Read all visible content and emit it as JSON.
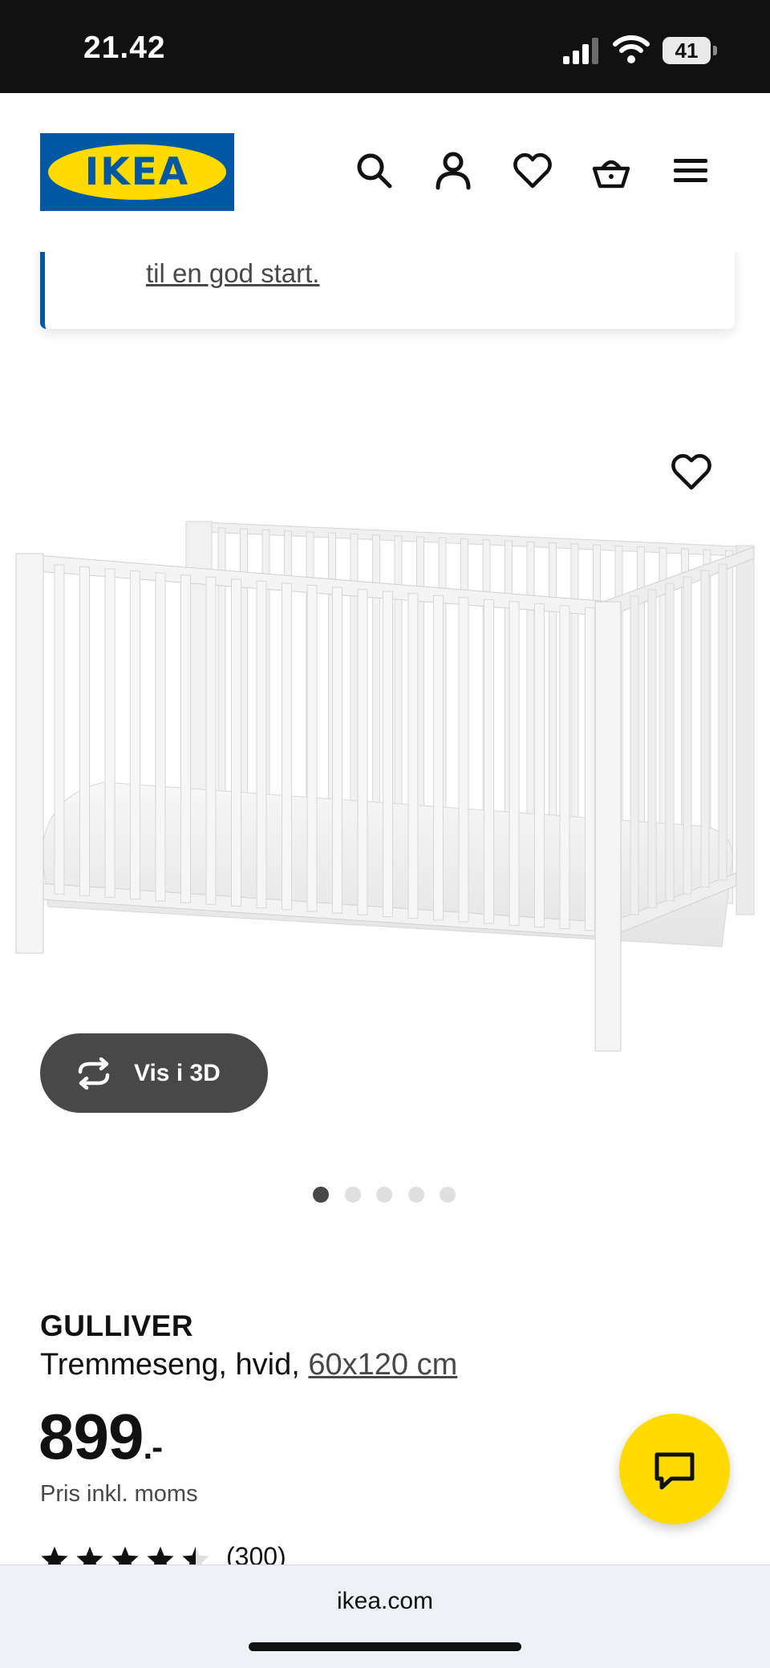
{
  "status_bar": {
    "time": "21.42",
    "battery": "41"
  },
  "header": {
    "logo_text": "IKEA",
    "icons": [
      "search-icon",
      "account-icon",
      "heart-icon",
      "basket-icon",
      "menu-icon"
    ]
  },
  "notice": {
    "link_text": "til en god start."
  },
  "product": {
    "view_3d_label": "Vis i 3D",
    "carousel": {
      "count": 5,
      "active": 1
    },
    "name": "GULLIVER",
    "description": "Tremmeseng, hvid, ",
    "size": "60x120 cm",
    "price": "899",
    "price_suffix": ".-",
    "price_note": "Pris inkl. moms",
    "rating": {
      "stars": 4.5,
      "count_label": "(300)"
    }
  },
  "browser": {
    "url": "ikea.com"
  },
  "colors": {
    "brand_blue": "#0058a3",
    "brand_yellow": "#ffdb00",
    "dark_gray": "#484848",
    "status_bar": "#111111"
  }
}
